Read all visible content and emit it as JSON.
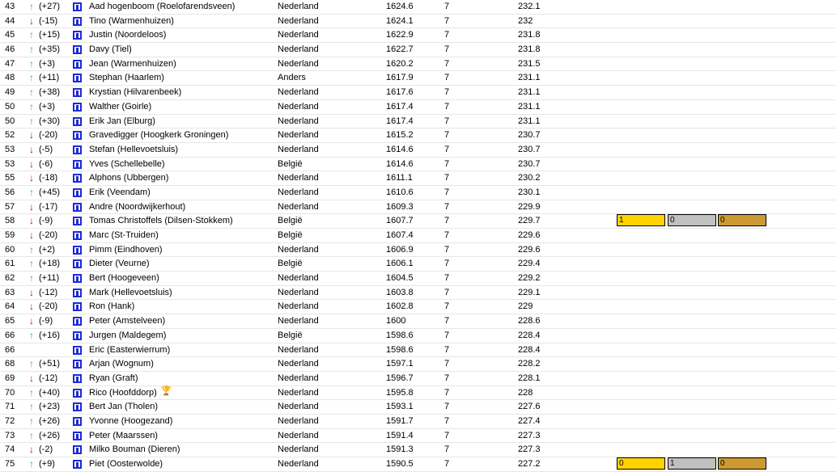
{
  "colors": {
    "up": "#22c92a",
    "down": "#d40000",
    "icon": "#1c2bd6",
    "gold": "#ffd200",
    "silver": "#c0c0c0",
    "bronze": "#cc9933"
  },
  "rows": [
    {
      "rank": "43",
      "dir": "up",
      "change": "(+27)",
      "name": "Aad hogenboom (Roelofarendsveen)",
      "country": "Nederland",
      "score": "1624.6",
      "games": "7",
      "avg": "232.1"
    },
    {
      "rank": "44",
      "dir": "down",
      "change": "(-15)",
      "name": "Tino (Warmenhuizen)",
      "country": "Nederland",
      "score": "1624.1",
      "games": "7",
      "avg": "232"
    },
    {
      "rank": "45",
      "dir": "up",
      "change": "(+15)",
      "name": "Justin (Noordeloos)",
      "country": "Nederland",
      "score": "1622.9",
      "games": "7",
      "avg": "231.8"
    },
    {
      "rank": "46",
      "dir": "up",
      "change": "(+35)",
      "name": "Davy (Tiel)",
      "country": "Nederland",
      "score": "1622.7",
      "games": "7",
      "avg": "231.8"
    },
    {
      "rank": "47",
      "dir": "up",
      "change": "(+3)",
      "name": "Jean (Warmenhuizen)",
      "country": "Nederland",
      "score": "1620.2",
      "games": "7",
      "avg": "231.5"
    },
    {
      "rank": "48",
      "dir": "up",
      "change": "(+11)",
      "name": "Stephan (Haarlem)",
      "country": "Anders",
      "score": "1617.9",
      "games": "7",
      "avg": "231.1"
    },
    {
      "rank": "49",
      "dir": "up",
      "change": "(+38)",
      "name": "Krystian (Hilvarenbeek)",
      "country": "Nederland",
      "score": "1617.6",
      "games": "7",
      "avg": "231.1"
    },
    {
      "rank": "50",
      "dir": "up",
      "change": "(+3)",
      "name": "Walther (Goirle)",
      "country": "Nederland",
      "score": "1617.4",
      "games": "7",
      "avg": "231.1"
    },
    {
      "rank": "50",
      "dir": "up",
      "change": "(+30)",
      "name": "Erik Jan (Elburg)",
      "country": "Nederland",
      "score": "1617.4",
      "games": "7",
      "avg": "231.1"
    },
    {
      "rank": "52",
      "dir": "down",
      "change": "(-20)",
      "name": "Gravedigger (Hoogkerk Groningen)",
      "country": "Nederland",
      "score": "1615.2",
      "games": "7",
      "avg": "230.7"
    },
    {
      "rank": "53",
      "dir": "down",
      "change": "(-5)",
      "name": "Stefan (Hellevoetsluis)",
      "country": "Nederland",
      "score": "1614.6",
      "games": "7",
      "avg": "230.7"
    },
    {
      "rank": "53",
      "dir": "down",
      "change": "(-6)",
      "name": "Yves (Schellebelle)",
      "country": "België",
      "score": "1614.6",
      "games": "7",
      "avg": "230.7"
    },
    {
      "rank": "55",
      "dir": "down",
      "change": "(-18)",
      "name": "Alphons (Ubbergen)",
      "country": "Nederland",
      "score": "1611.1",
      "games": "7",
      "avg": "230.2"
    },
    {
      "rank": "56",
      "dir": "up",
      "change": "(+45)",
      "name": "Erik (Veendam)",
      "country": "Nederland",
      "score": "1610.6",
      "games": "7",
      "avg": "230.1"
    },
    {
      "rank": "57",
      "dir": "down",
      "change": "(-17)",
      "name": "Andre (Noordwijkerhout)",
      "country": "Nederland",
      "score": "1609.3",
      "games": "7",
      "avg": "229.9"
    },
    {
      "rank": "58",
      "dir": "down",
      "change": "(-9)",
      "name": "Tomas Christoffels (Dilsen-Stokkem)",
      "country": "België",
      "score": "1607.7",
      "games": "7",
      "avg": "229.7",
      "medals": {
        "gold": "1",
        "silver": "0",
        "bronze": "0"
      }
    },
    {
      "rank": "59",
      "dir": "down",
      "change": "(-20)",
      "name": "Marc (St-Truiden)",
      "country": "België",
      "score": "1607.4",
      "games": "7",
      "avg": "229.6"
    },
    {
      "rank": "60",
      "dir": "up",
      "change": "(+2)",
      "name": "Pimm (Eindhoven)",
      "country": "Nederland",
      "score": "1606.9",
      "games": "7",
      "avg": "229.6"
    },
    {
      "rank": "61",
      "dir": "up",
      "change": "(+18)",
      "name": "Dieter (Veurne)",
      "country": "België",
      "score": "1606.1",
      "games": "7",
      "avg": "229.4"
    },
    {
      "rank": "62",
      "dir": "up",
      "change": "(+11)",
      "name": "Bert (Hoogeveen)",
      "country": "Nederland",
      "score": "1604.5",
      "games": "7",
      "avg": "229.2"
    },
    {
      "rank": "63",
      "dir": "down",
      "change": "(-12)",
      "name": "Mark (Hellevoetsluis)",
      "country": "Nederland",
      "score": "1603.8",
      "games": "7",
      "avg": "229.1"
    },
    {
      "rank": "64",
      "dir": "down",
      "change": "(-20)",
      "name": "Ron (Hank)",
      "country": "Nederland",
      "score": "1602.8",
      "games": "7",
      "avg": "229"
    },
    {
      "rank": "65",
      "dir": "down",
      "change": "(-9)",
      "name": "Peter (Amstelveen)",
      "country": "Nederland",
      "score": "1600",
      "games": "7",
      "avg": "228.6"
    },
    {
      "rank": "66",
      "dir": "up",
      "change": "(+16)",
      "name": "Jurgen (Maldegem)",
      "country": "België",
      "score": "1598.6",
      "games": "7",
      "avg": "228.4"
    },
    {
      "rank": "66",
      "dir": "",
      "change": "",
      "name": "Eric (Easterwierrum)",
      "country": "Nederland",
      "score": "1598.6",
      "games": "7",
      "avg": "228.4"
    },
    {
      "rank": "68",
      "dir": "up",
      "change": "(+51)",
      "name": "Arjan (Wognum)",
      "country": "Nederland",
      "score": "1597.1",
      "games": "7",
      "avg": "228.2"
    },
    {
      "rank": "69",
      "dir": "down",
      "change": "(-12)",
      "name": "Ryan (Graft)",
      "country": "Nederland",
      "score": "1596.7",
      "games": "7",
      "avg": "228.1"
    },
    {
      "rank": "70",
      "dir": "up",
      "change": "(+40)",
      "name": "Rico (Hoofddorp)",
      "country": "Nederland",
      "score": "1595.8",
      "games": "7",
      "avg": "228",
      "trophy": true
    },
    {
      "rank": "71",
      "dir": "up",
      "change": "(+23)",
      "name": "Bert Jan (Tholen)",
      "country": "Nederland",
      "score": "1593.1",
      "games": "7",
      "avg": "227.6"
    },
    {
      "rank": "72",
      "dir": "up",
      "change": "(+26)",
      "name": "Yvonne (Hoogezand)",
      "country": "Nederland",
      "score": "1591.7",
      "games": "7",
      "avg": "227.4"
    },
    {
      "rank": "73",
      "dir": "up",
      "change": "(+26)",
      "name": "Peter (Maarssen)",
      "country": "Nederland",
      "score": "1591.4",
      "games": "7",
      "avg": "227.3"
    },
    {
      "rank": "74",
      "dir": "down",
      "change": "(-2)",
      "name": "Milko Bouman (Dieren)",
      "country": "Nederland",
      "score": "1591.3",
      "games": "7",
      "avg": "227.3"
    },
    {
      "rank": "75",
      "dir": "up",
      "change": "(+9)",
      "name": "Piet (Oosterwolde)",
      "country": "Nederland",
      "score": "1590.5",
      "games": "7",
      "avg": "227.2",
      "medals": {
        "gold": "0",
        "silver": "1",
        "bronze": "0"
      }
    }
  ]
}
